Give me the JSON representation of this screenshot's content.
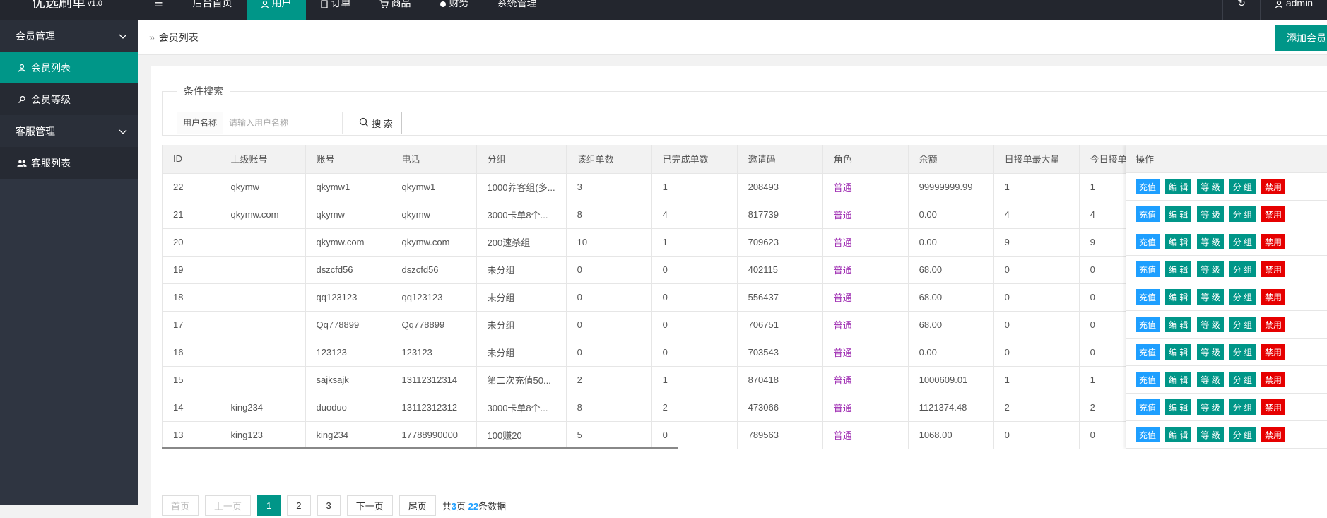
{
  "header": {
    "logo": "优选刷单",
    "logo_ver": "v1.0",
    "menu_toggle": "☰",
    "nav": [
      {
        "label": "后台首页",
        "icon": ""
      },
      {
        "label": "用户",
        "icon": "user-icon"
      },
      {
        "label": "订单",
        "icon": "document-icon"
      },
      {
        "label": "商品",
        "icon": "cart-icon"
      },
      {
        "label": "财务",
        "icon": "money-icon"
      },
      {
        "label": "系统管理",
        "icon": ""
      }
    ],
    "refresh": "↻",
    "admin": "admin"
  },
  "sidebar": {
    "groups": [
      {
        "label": "会员管理",
        "items": [
          {
            "label": "会员列表",
            "icon": "user-icon"
          },
          {
            "label": "会员等级",
            "icon": "key-icon"
          }
        ]
      },
      {
        "label": "客服管理",
        "items": [
          {
            "label": "客服列表",
            "icon": "users-icon"
          }
        ]
      }
    ]
  },
  "breadcrumb": {
    "text": "会员列表"
  },
  "add_button": "添加会员",
  "search": {
    "legend": "条件搜索",
    "label": "用户名称",
    "placeholder": "请输入用户名称",
    "button": "搜 索"
  },
  "table": {
    "columns": [
      "ID",
      "上级账号",
      "账号",
      "电话",
      "分组",
      "该组单数",
      "已完成单数",
      "邀请码",
      "角色",
      "余额",
      "日接单最大量",
      "今日接单数",
      "操作"
    ],
    "rows": [
      [
        "22",
        "qkymw",
        "qkymw1",
        "qkymw1",
        "1000养客组(多...",
        "3",
        "1",
        "208493",
        "普通",
        "99999999.99",
        "1",
        "1"
      ],
      [
        "21",
        "qkymw.com",
        "qkymw",
        "qkymw",
        "3000卡单8个...",
        "8",
        "4",
        "817739",
        "普通",
        "0.00",
        "4",
        "4"
      ],
      [
        "20",
        "",
        "qkymw.com",
        "qkymw.com",
        "200速杀组",
        "10",
        "1",
        "709623",
        "普通",
        "0.00",
        "9",
        "9"
      ],
      [
        "19",
        "",
        "dszcfd56",
        "dszcfd56",
        "未分组",
        "0",
        "0",
        "402115",
        "普通",
        "68.00",
        "0",
        "0"
      ],
      [
        "18",
        "",
        "qq123123",
        "qq123123",
        "未分组",
        "0",
        "0",
        "556437",
        "普通",
        "68.00",
        "0",
        "0"
      ],
      [
        "17",
        "",
        "Qq778899",
        "Qq778899",
        "未分组",
        "0",
        "0",
        "706751",
        "普通",
        "68.00",
        "0",
        "0"
      ],
      [
        "16",
        "",
        "123123",
        "123123",
        "未分组",
        "0",
        "0",
        "703543",
        "普通",
        "0.00",
        "0",
        "0"
      ],
      [
        "15",
        "",
        "sajksajk",
        "13112312314",
        "第二次充值50...",
        "2",
        "1",
        "870418",
        "普通",
        "1000609.01",
        "1",
        "1"
      ],
      [
        "14",
        "king234",
        "duoduo",
        "13112312312",
        "3000卡单8个...",
        "8",
        "2",
        "473066",
        "普通",
        "1121374.48",
        "2",
        "2"
      ],
      [
        "13",
        "king123",
        "king234",
        "17788990000",
        "100赚20",
        "5",
        "0",
        "789563",
        "普通",
        "1068.00",
        "0",
        "0"
      ]
    ],
    "ops": [
      "充值",
      "编 辑",
      "等 级",
      "分 组",
      "禁用"
    ]
  },
  "pager": {
    "first": "首页",
    "prev": "上一页",
    "pages": [
      "1",
      "2",
      "3"
    ],
    "next": "下一页",
    "last": "尾页",
    "info_prefix": "共",
    "total_pages": "3",
    "info_mid": "页 ",
    "total_items": "22",
    "info_suffix": "条数据"
  },
  "colors": {
    "accent": "#009688",
    "topbar": "#23262e",
    "sidebar": "#2f3541",
    "blue": "#1e9fff",
    "red": "#e60000",
    "role": "#9c27b0"
  }
}
